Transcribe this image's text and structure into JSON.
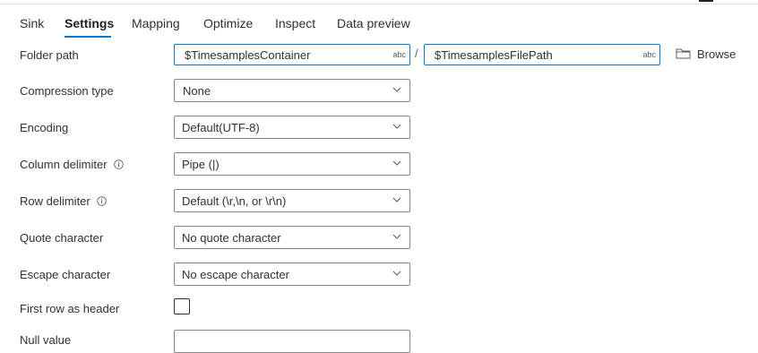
{
  "tabs": [
    {
      "label": "Sink",
      "active": false
    },
    {
      "label": "Settings",
      "active": true
    },
    {
      "label": "Mapping",
      "active": false
    },
    {
      "label": "Optimize",
      "active": false
    },
    {
      "label": "Inspect",
      "active": false
    },
    {
      "label": "Data preview",
      "active": false
    }
  ],
  "colors": {
    "accent": "#0078d4",
    "text": "#323130",
    "border": "#8a8886"
  },
  "folder_path": {
    "label": "Folder path",
    "container_value": "$TimesamplesContainer",
    "container_badge": "abc",
    "separator": "/",
    "file_path_value": "$TimesamplesFilePath",
    "file_path_badge": "abc",
    "browse_label": "Browse",
    "browse_icon": "folder-icon"
  },
  "fields": {
    "compression_type": {
      "label": "Compression type",
      "value": "None"
    },
    "encoding": {
      "label": "Encoding",
      "value": "Default(UTF-8)"
    },
    "column_delimiter": {
      "label": "Column delimiter",
      "value": "Pipe (|)",
      "info_icon": "info-icon"
    },
    "row_delimiter": {
      "label": "Row delimiter",
      "value": "Default (\\r,\\n, or \\r\\n)",
      "info_icon": "info-icon"
    },
    "quote_character": {
      "label": "Quote character",
      "value": "No quote character"
    },
    "escape_character": {
      "label": "Escape character",
      "value": "No escape character"
    },
    "first_row_as_header": {
      "label": "First row as header",
      "checked": false
    },
    "null_value": {
      "label": "Null value",
      "value": ""
    }
  }
}
